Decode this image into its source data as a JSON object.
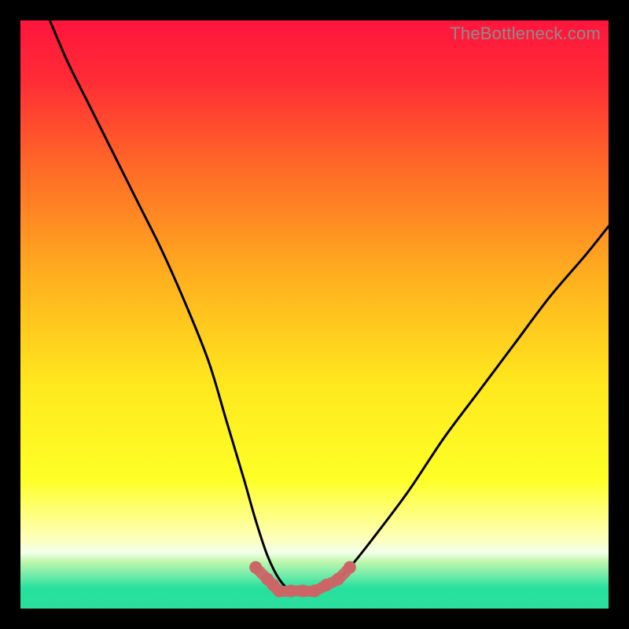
{
  "watermark": "TheBottleneck.com",
  "chart_data": {
    "type": "line",
    "title": "",
    "xlabel": "",
    "ylabel": "",
    "xlim": [
      0,
      100
    ],
    "ylim": [
      0,
      100
    ],
    "gradient_stops": [
      {
        "offset": 0.0,
        "color": "#ff153d"
      },
      {
        "offset": 0.1,
        "color": "#ff2b36"
      },
      {
        "offset": 0.25,
        "color": "#ff6a27"
      },
      {
        "offset": 0.45,
        "color": "#ffb41e"
      },
      {
        "offset": 0.62,
        "color": "#ffe81e"
      },
      {
        "offset": 0.78,
        "color": "#feff26"
      },
      {
        "offset": 0.88,
        "color": "#fdffb9"
      },
      {
        "offset": 0.905,
        "color": "#f2ffea"
      },
      {
        "offset": 0.92,
        "color": "#bef7ad"
      },
      {
        "offset": 0.94,
        "color": "#7eedab"
      },
      {
        "offset": 0.965,
        "color": "#27e09d"
      },
      {
        "offset": 1.0,
        "color": "#2bdf9d"
      }
    ],
    "series": [
      {
        "name": "bottleneck-curve",
        "x": [
          5,
          8,
          12,
          16,
          20,
          24,
          28,
          32,
          35,
          38,
          40,
          42,
          44,
          46,
          48,
          50,
          53,
          56,
          60,
          66,
          72,
          78,
          84,
          90,
          96,
          100
        ],
        "y": [
          100,
          93,
          85,
          77,
          69,
          61,
          52,
          42,
          32,
          22,
          15,
          9,
          5,
          3,
          3,
          3,
          4,
          7,
          12,
          20,
          29,
          37,
          45,
          53,
          60,
          65
        ]
      },
      {
        "name": "flat-marker-band",
        "x": [
          40,
          42,
          43,
          44,
          46,
          48,
          50,
          52,
          54,
          56
        ],
        "y": [
          7,
          5,
          4,
          3,
          3,
          3,
          3,
          4,
          5,
          7
        ]
      }
    ],
    "marker_color": "#cc6666",
    "curve_color": "#000000"
  }
}
